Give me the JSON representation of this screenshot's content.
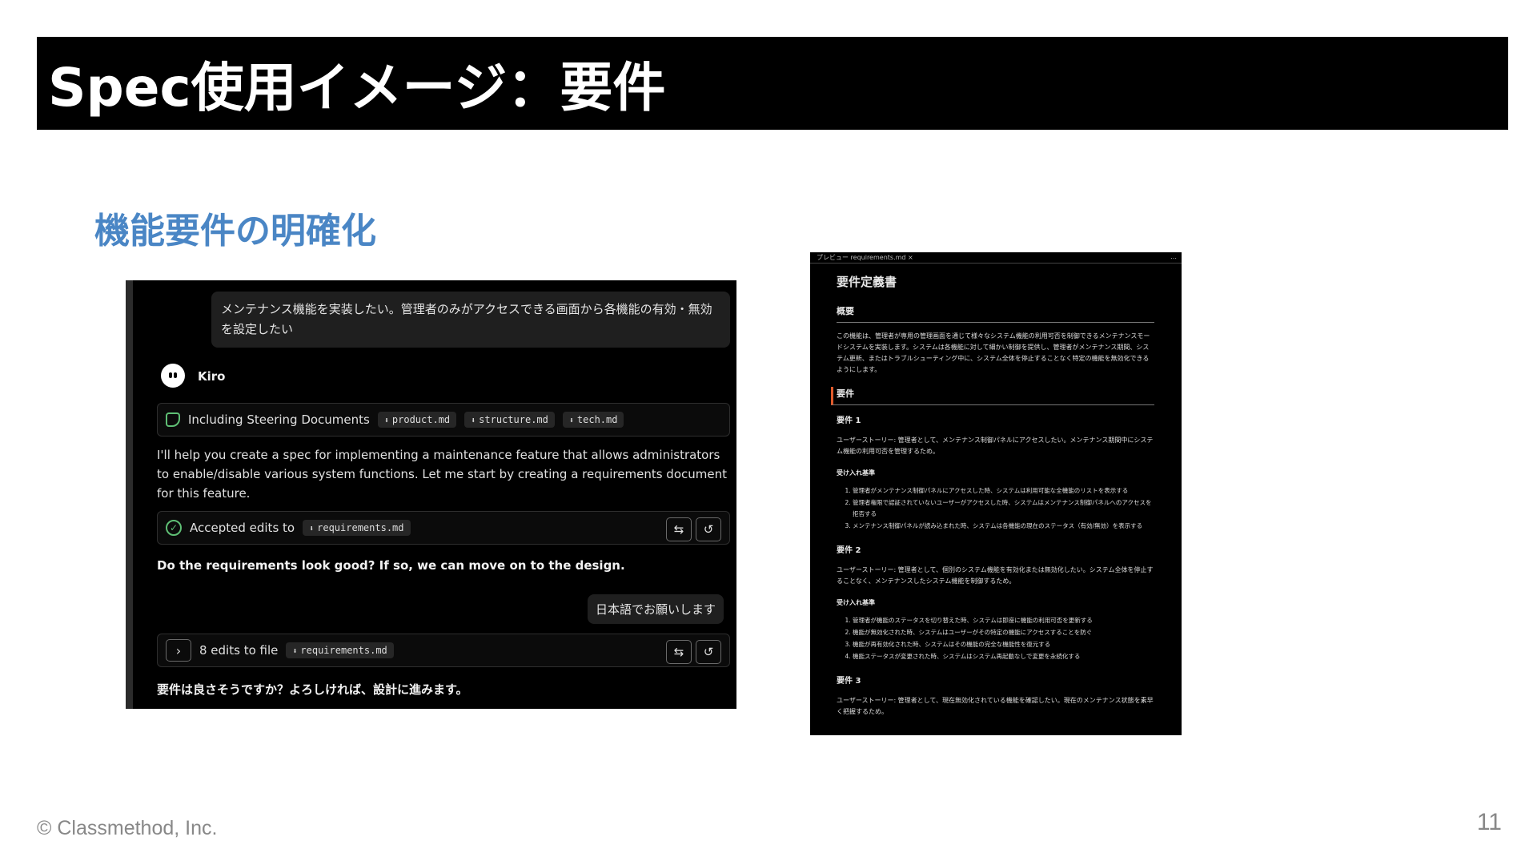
{
  "slide": {
    "title": "Spec使用イメージ：要件",
    "subtitle": "機能要件の明確化",
    "footer": "© Classmethod, Inc.",
    "page_number": "11"
  },
  "chat": {
    "user_message_1": "メンテナンス機能を実装したい。管理者のみがアクセスできる画面から各機能の有効・無効を設定したい",
    "assistant_name": "Kiro",
    "steering": {
      "label": "Including Steering Documents",
      "files": [
        "product.md",
        "structure.md",
        "tech.md"
      ]
    },
    "assistant_message": "I'll help you create a spec for implementing a maintenance feature that allows administrators to enable/disable various system functions. Let me start by creating a requirements document for this feature.",
    "accepted": {
      "label": "Accepted edits to",
      "file": "requirements.md"
    },
    "question": "Do the requirements look good? If so, we can move on to the design.",
    "user_message_2": "日本語でお願いします",
    "edits": {
      "label": "8 edits to file",
      "file": "requirements.md"
    },
    "final_message": "要件は良さそうですか？よろしければ、設計に進みます。",
    "chevron_glyph": "›",
    "action_icons": {
      "diff": "⇆",
      "undo": "↺"
    }
  },
  "doc": {
    "tab_label": "プレビュー requirements.md",
    "tab_close": "×",
    "tab_more": "…",
    "title": "要件定義書",
    "overview_heading": "概要",
    "overview_text": "この機能は、管理者が専用の管理画面を通じて様々なシステム機能の利用可否を制御できるメンテナンスモードシステムを実装します。システムは各機能に対して細かい制御を提供し、管理者がメンテナンス期間、システム更新、またはトラブルシューティング中に、システム全体を停止することなく特定の機能を無効化できるようにします。",
    "requirements_heading": "要件",
    "requirements": [
      {
        "title": "要件 1",
        "story": "ユーザーストーリー: 管理者として、メンテナンス制御パネルにアクセスしたい。メンテナンス期間中にシステム機能の利用可否を管理するため。",
        "criteria_heading": "受け入れ基準",
        "criteria": [
          "管理者がメンテナンス制御パネルにアクセスした時、システムは利用可能な全機能のリストを表示する",
          "管理者権限で認証されていないユーザーがアクセスした時、システムはメンテナンス制御パネルへのアクセスを拒否する",
          "メンテナンス制御パネルが読み込まれた時、システムは各機能の現在のステータス（有効/無効）を表示する"
        ]
      },
      {
        "title": "要件 2",
        "story": "ユーザーストーリー: 管理者として、個別のシステム機能を有効化または無効化したい。システム全体を停止することなく、メンテナンスしたシステム機能を制御するため。",
        "criteria_heading": "受け入れ基準",
        "criteria": [
          "管理者が機能のステータスを切り替えた時、システムは即座に機能の利用可否を更新する",
          "機能が無効化された時、システムはユーザーがその特定の機能にアクセスすることを防ぐ",
          "機能が再有効化された時、システムはその機能の完全な機能性を復元する",
          "機能ステータスが変更された時、システムはシステム再起動なしで変更を永続化する"
        ]
      },
      {
        "title": "要件 3",
        "story": "ユーザーストーリー: 管理者として、現在無効化されている機能を確認したい。現在のメンテナンス状態を素早く把握するため。"
      }
    ]
  }
}
